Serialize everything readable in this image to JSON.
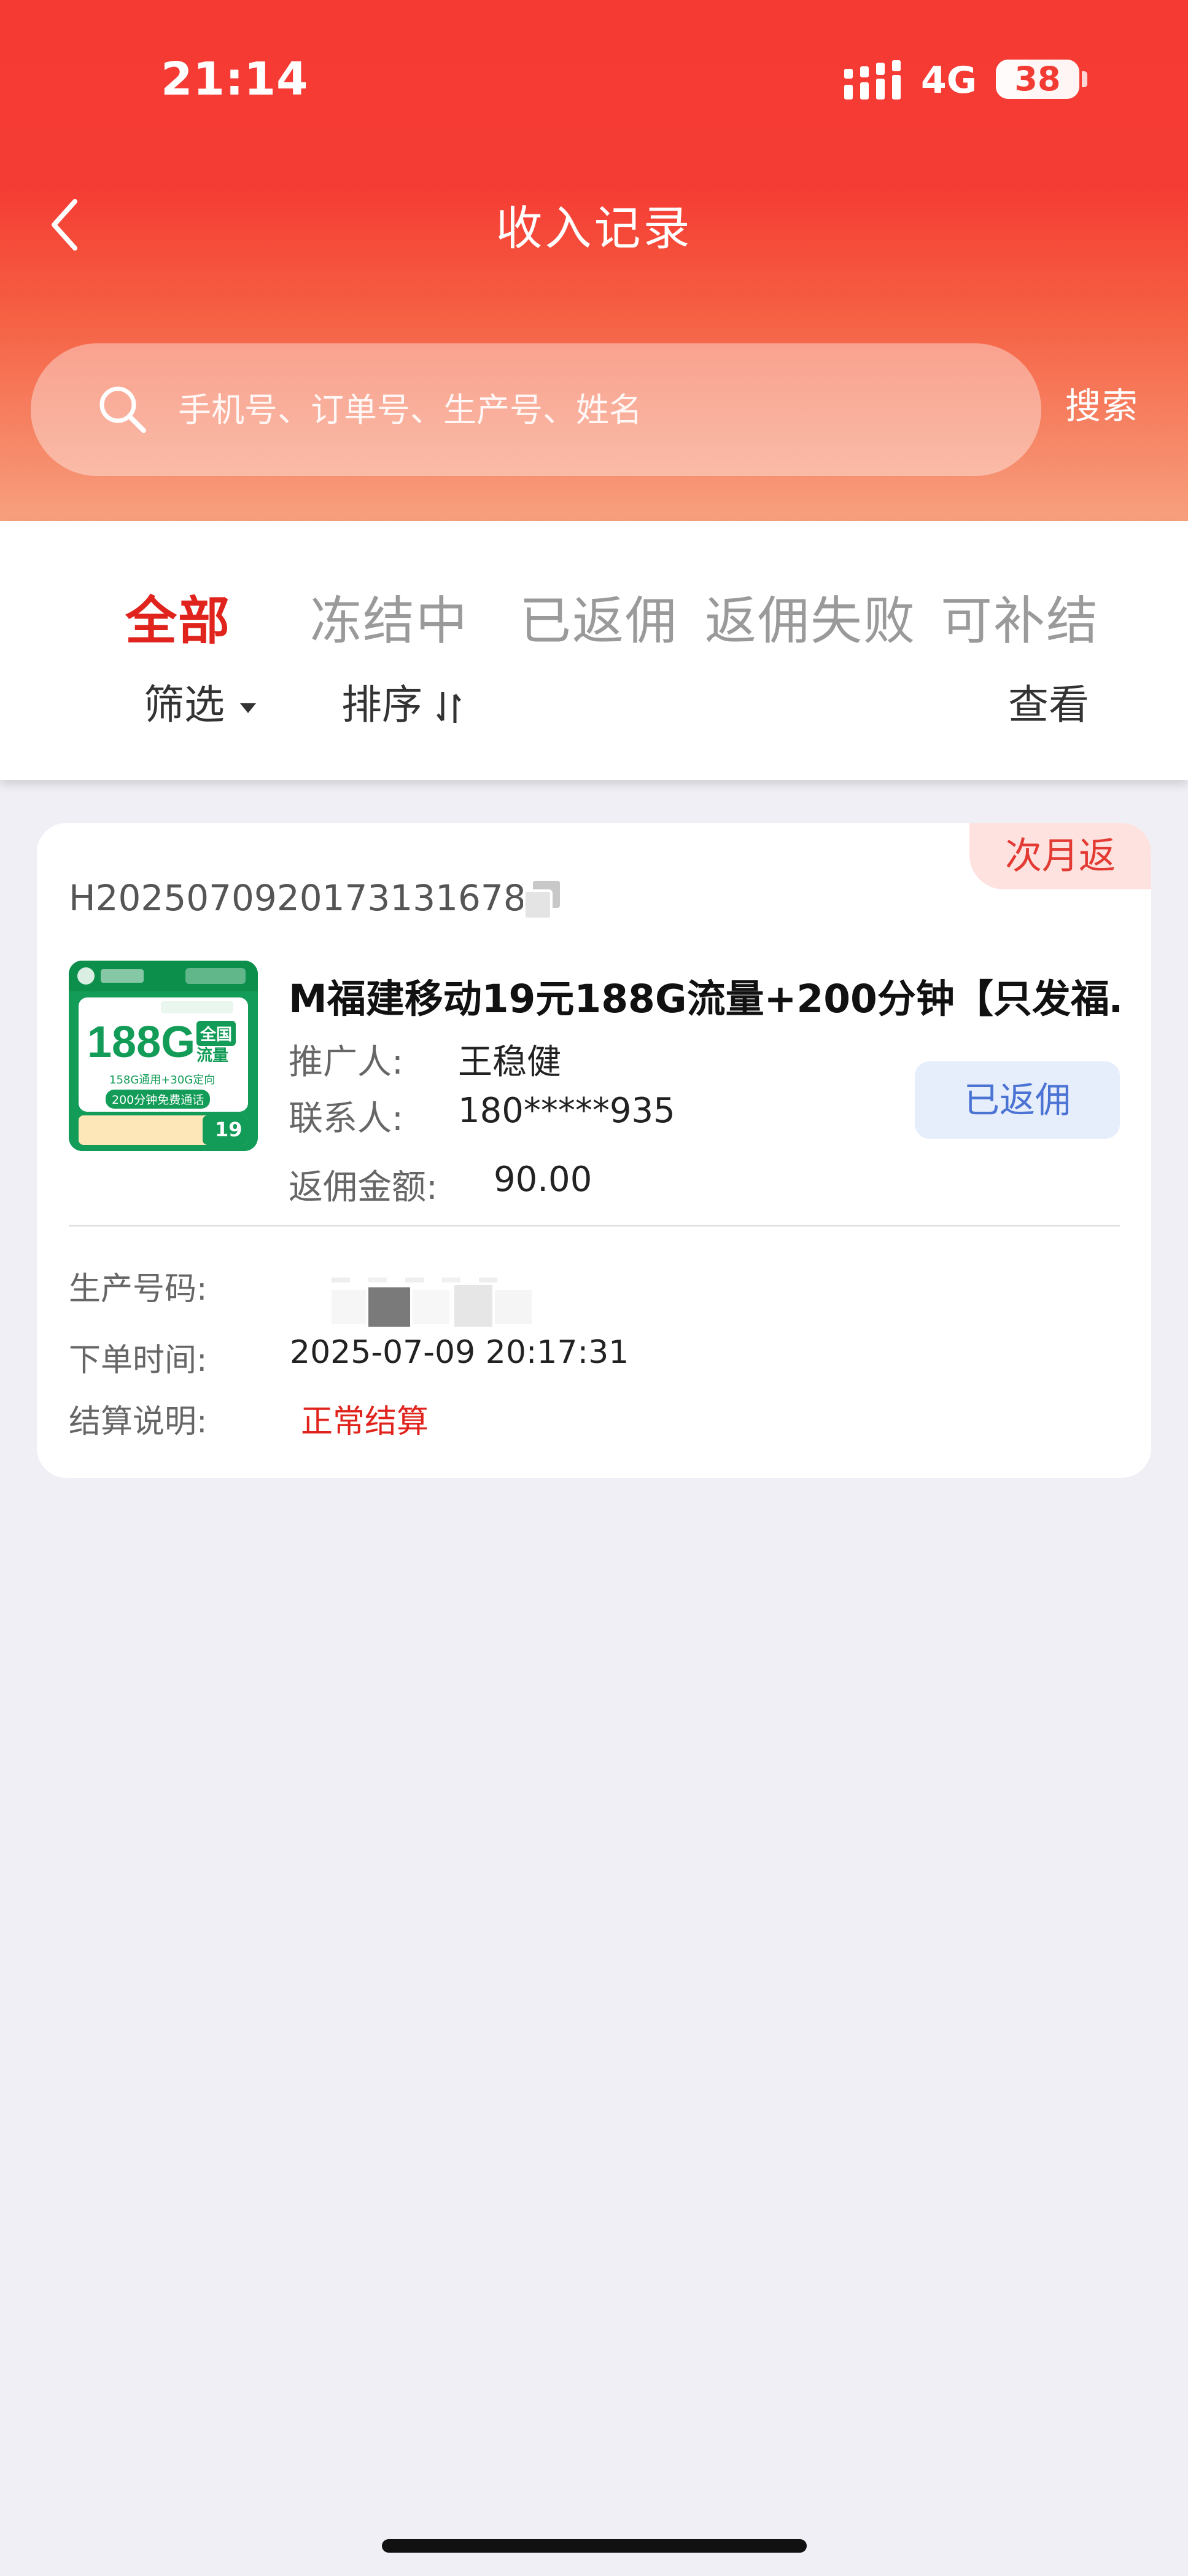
{
  "status_bar": {
    "time": "21:14",
    "network": "4G",
    "battery": "38",
    "battery_level": 0.38
  },
  "nav": {
    "title": "收入记录",
    "back_icon": "chevron-left-icon"
  },
  "search": {
    "placeholder": "手机号、订单号、生产号、姓名",
    "button_label": "搜索",
    "icon": "search-icon"
  },
  "tabs": [
    {
      "label": "全部",
      "active": true
    },
    {
      "label": "冻结中",
      "active": false
    },
    {
      "label": "已返佣",
      "active": false
    },
    {
      "label": "返佣失败",
      "active": false
    },
    {
      "label": "可补结",
      "active": false
    }
  ],
  "toolbar": {
    "filter_label": "筛选",
    "sort_label": "排序",
    "view_label": "查看"
  },
  "colors": {
    "accent_red": "#e0231c",
    "header_top": "#f53a34",
    "header_bottom": "#f7a07e",
    "status_blue": "#4b73d4"
  },
  "order": {
    "corner_tag": "次月返",
    "order_no": "H2025070920173131678",
    "product_title": "M福建移动19元188G流量+200分钟【只发福…",
    "promoter_label": "推广人:",
    "promoter_value": "王稳健",
    "contact_label": "联系人:",
    "contact_value": "180*****935",
    "amount_label": "返佣金额:",
    "amount_value": "90.00",
    "status_button": "已返佣",
    "production_label": "生产号码:",
    "order_time_label": "下单时间:",
    "order_time_value": "2025-07-09 20:17:31",
    "settlement_label": "结算说明:",
    "settlement_value": "正常结算",
    "thumbnail": {
      "big_text": "188G",
      "side_text_1": "全国",
      "side_text_2": "流量",
      "line_1": "158G通用+30G定向",
      "line_2": "200分钟免费通话",
      "price": "19"
    }
  }
}
